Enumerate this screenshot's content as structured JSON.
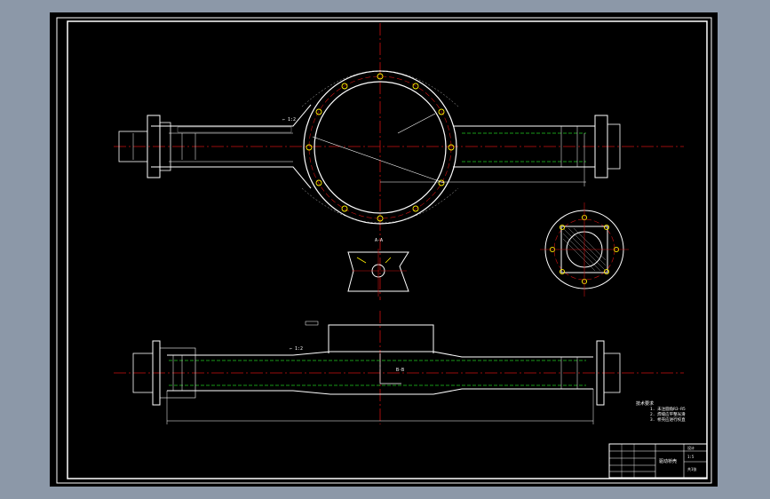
{
  "colors": {
    "background_frame": "#8c98a8",
    "drawing_area": "#000000",
    "geometry": "#ffffff",
    "centerline": "#cc1111",
    "hidden_line": "#22cc22",
    "bolt_hole": "#ffee00",
    "hatch": "#bbbbbb"
  },
  "annotations": {
    "section_marker_top": "A-A",
    "section_marker_mid": "B-B",
    "tech_requirements_title": "技术要求",
    "tech_requirements_lines": [
      "1. 未注圆角R3-R5",
      "2. 焊缝应平整光滑",
      "3. 桥壳应进行校直"
    ]
  },
  "title_block": {
    "drawing_title": "驱动桥壳",
    "company": "设计",
    "scale": "1:5",
    "sheet": "共1张"
  }
}
